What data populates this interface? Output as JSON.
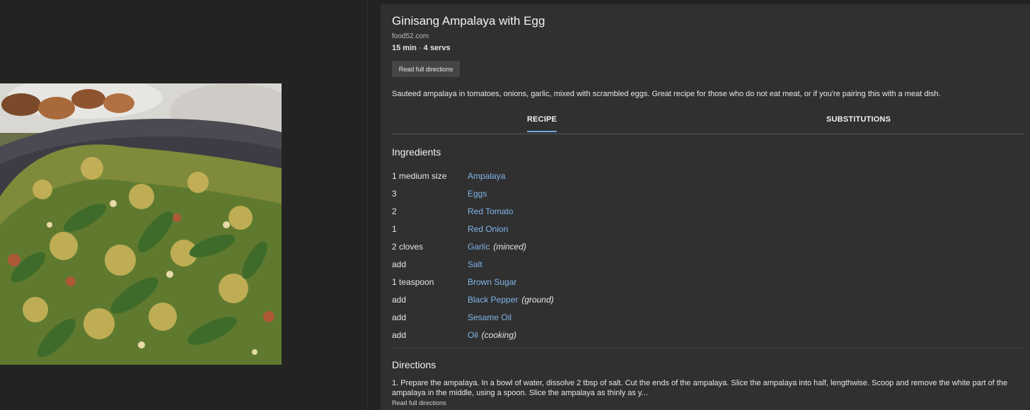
{
  "recipe": {
    "title": "Ginisang Ampalaya with Egg",
    "source": "food52.com",
    "time": "15 min",
    "meta_sep": " · ",
    "servings": "4 servs",
    "read_full_button": "Read full directions",
    "description": "Sauteed ampalaya in tomatoes, onions, garlic, mixed with scrambled eggs. Great recipe for those who do not eat meat, or if you're pairing this with a meat dish."
  },
  "tabs": [
    {
      "label": "RECIPE",
      "active": true
    },
    {
      "label": "SUBSTITUTIONS",
      "active": false
    }
  ],
  "ingredients_heading": "Ingredients",
  "ingredients": [
    {
      "qty": "1 medium size",
      "name": "Ampalaya",
      "note": ""
    },
    {
      "qty": "3",
      "name": "Eggs",
      "note": ""
    },
    {
      "qty": "2",
      "name": "Red Tomato",
      "note": ""
    },
    {
      "qty": "1",
      "name": "Red Onion",
      "note": ""
    },
    {
      "qty": "2 cloves",
      "name": "Garlic",
      "note": "(minced)"
    },
    {
      "qty": "add",
      "name": "Salt",
      "note": ""
    },
    {
      "qty": "1 teaspoon",
      "name": "Brown Sugar",
      "note": ""
    },
    {
      "qty": "add",
      "name": "Black Pepper",
      "note": "(ground)"
    },
    {
      "qty": "add",
      "name": "Sesame Oil",
      "note": ""
    },
    {
      "qty": "add",
      "name": "Oil",
      "note": "(cooking)"
    }
  ],
  "directions_heading": "Directions",
  "directions_text": "1. Prepare the ampalaya. In a bowl of water, dissolve 2 tbsp of salt. Cut the ends of the ampalaya. Slice the ampalaya into half, lengthwise. Scoop and remove the white part of the ampalaya in the middle, using a spoon. Slice the ampalaya as thinly as y...",
  "directions_link": "Read full directions",
  "colors": {
    "background": "#232323",
    "card": "#303030",
    "link": "#7fb5e8",
    "tab_underline": "#6fa8dc"
  }
}
